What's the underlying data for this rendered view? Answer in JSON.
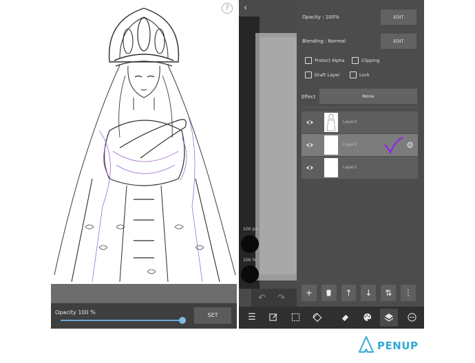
{
  "left_screen": {
    "help_glyph": "?",
    "opacity_label": "Opacity 100 %",
    "opacity_value": 100,
    "set_label": "SET"
  },
  "right_screen": {
    "brush_size_label": "100 px",
    "brush_opacity_label": "100 %",
    "layer_panel": {
      "opacity_label": "Opacity : 100%",
      "opacity_edit_label": "EDIT",
      "blending_label": "Blending : Normal",
      "blending_edit_label": "EDIT",
      "checkboxes": [
        {
          "label": "Protect Alpha",
          "checked": false
        },
        {
          "label": "Clipping",
          "checked": false
        },
        {
          "label": "Draft Layer",
          "checked": false
        },
        {
          "label": "Lock",
          "checked": false
        }
      ],
      "effect_label": "Effect",
      "effect_value": "None",
      "layers": [
        {
          "name": "Layer3",
          "visible": true,
          "selected": false,
          "thumbnail": "sketch"
        },
        {
          "name": "Layer2",
          "visible": true,
          "selected": true,
          "thumbnail": "blank"
        },
        {
          "name": "Layer1",
          "visible": true,
          "selected": false,
          "thumbnail": "blank"
        }
      ],
      "layer_tools": [
        "add-icon",
        "trash-icon",
        "arrow-up-icon",
        "arrow-down-icon",
        "swap-icon",
        "more-icon"
      ]
    },
    "bottom_toolbar": [
      "menu-icon",
      "edit-icon",
      "selection-icon",
      "rotate-icon",
      "eraser-icon",
      "palette-icon",
      "layers-icon",
      "more-circle-icon"
    ],
    "active_tool": "layers-icon"
  },
  "logo": {
    "text": "PENUP"
  },
  "colors": {
    "panel_bg": "#4c4c4c",
    "selected_layer": "#7c7c7c",
    "check_mark": "#8a2be2",
    "slider": "#6aa9d9",
    "logo": "#33a9d6",
    "sketch_line": "#3a3a3a",
    "sketch_purple": "#9b6fd0"
  }
}
